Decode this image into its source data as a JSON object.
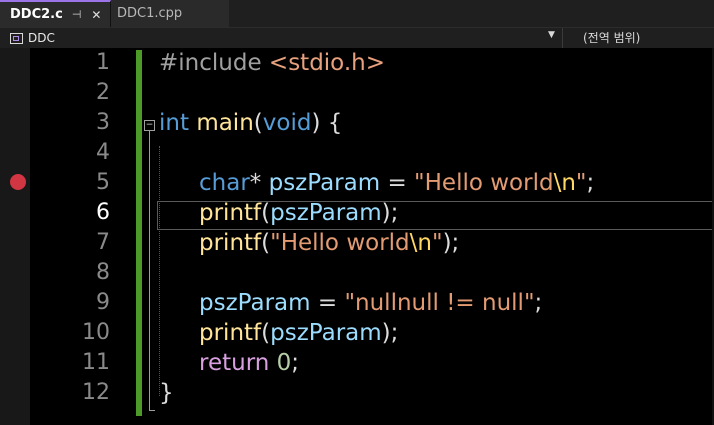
{
  "tabs": [
    {
      "title": "DDC2.c",
      "active": true,
      "pin_icon": "pin-icon",
      "close_icon": "close-icon"
    },
    {
      "title": "DDC1.cpp",
      "active": false
    }
  ],
  "navbar": {
    "project": "DDC",
    "scope": "(전역 범위)",
    "dropdown_icon": "chevron-down-icon"
  },
  "editor": {
    "current_line": 6,
    "breakpoint_line": 5,
    "line_numbers": [
      "1",
      "2",
      "3",
      "4",
      "5",
      "6",
      "7",
      "8",
      "9",
      "10",
      "11",
      "12"
    ]
  },
  "code": {
    "l1": {
      "directive": "#include",
      "header": "<stdio.h>"
    },
    "l3": {
      "type": "int",
      "name": "main",
      "open": "(",
      "param": "void",
      "close": ") {"
    },
    "l5": {
      "type": "char",
      "ptr": "* ",
      "var": "pszParam",
      "assign": " = ",
      "str": "\"Hello world",
      "esc": "\\n",
      "str_end": "\"",
      "semi": ";"
    },
    "l6": {
      "fn": "printf",
      "open": "(",
      "arg": "pszParam",
      "close": ");"
    },
    "l7": {
      "fn": "printf",
      "open": "(",
      "str": "\"Hello world",
      "esc": "\\n",
      "str_end": "\"",
      "close": ");"
    },
    "l9": {
      "var": "pszParam",
      "assign": " = ",
      "str": "\"nullnull != null\"",
      "semi": ";"
    },
    "l10": {
      "fn": "printf",
      "open": "(",
      "arg": "pszParam",
      "close": ");"
    },
    "l11": {
      "kw": "return",
      "space": " ",
      "num": "0",
      "semi": ";"
    },
    "l12": {
      "close": "}"
    }
  },
  "colors": {
    "keyword": "#569cd6",
    "function": "#ffe49a",
    "identifier": "#9cdcfe",
    "string": "#e39b73",
    "escape": "#ffd866",
    "control": "#d8a0df",
    "change_bar": "#4e9a28",
    "breakpoint": "#d13642",
    "tab_accent": "#9d74e8"
  }
}
